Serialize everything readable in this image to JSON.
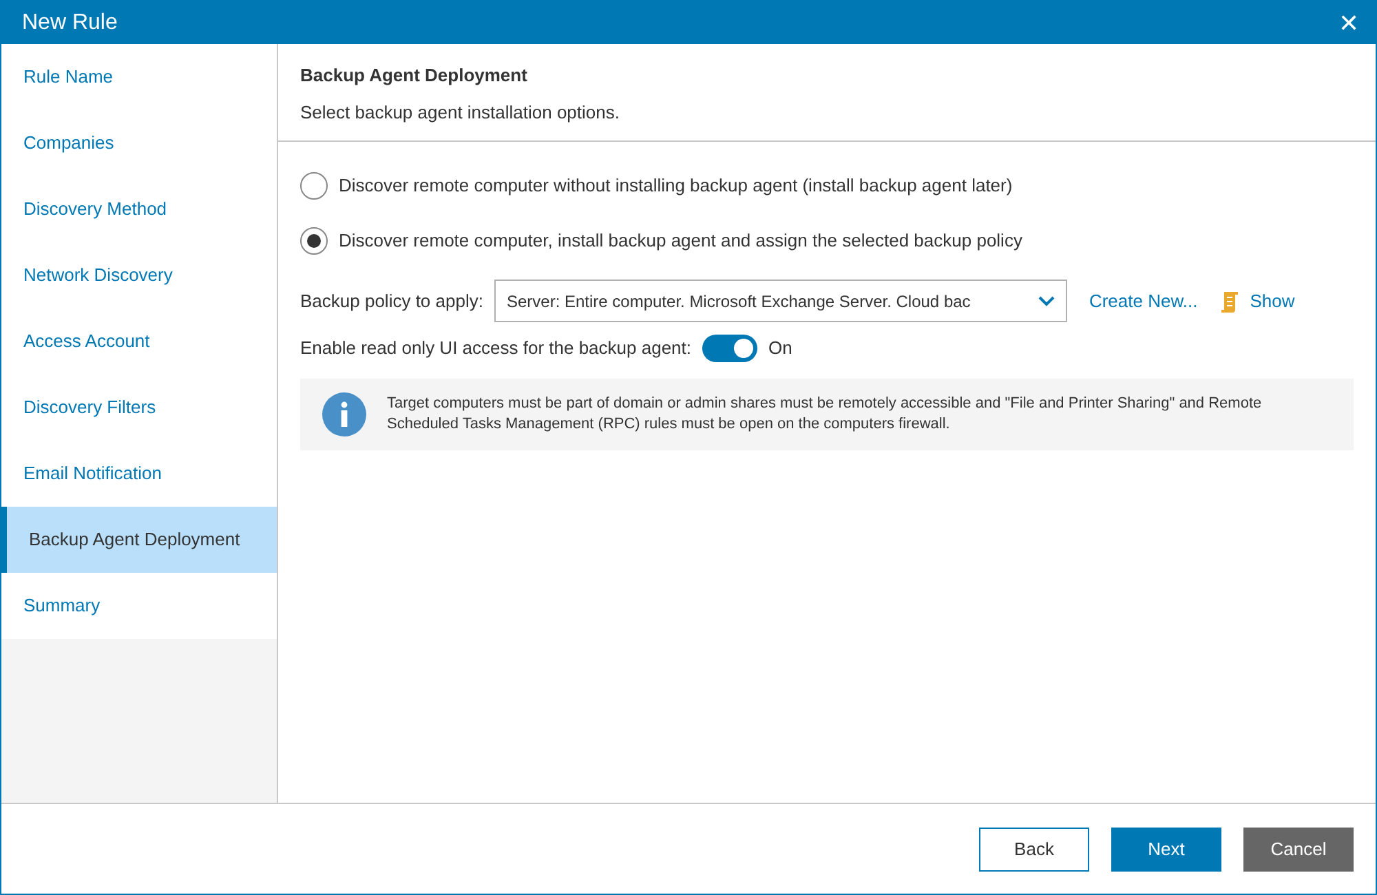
{
  "window": {
    "title": "New Rule",
    "close": "✕"
  },
  "sidebar": {
    "items": [
      {
        "label": "Rule Name",
        "selected": false
      },
      {
        "label": "Companies",
        "selected": false
      },
      {
        "label": "Discovery Method",
        "selected": false
      },
      {
        "label": "Network Discovery",
        "selected": false
      },
      {
        "label": "Access Account",
        "selected": false
      },
      {
        "label": "Discovery Filters",
        "selected": false
      },
      {
        "label": "Email Notification",
        "selected": false
      },
      {
        "label": "Backup Agent Deployment",
        "selected": true
      },
      {
        "label": "Summary",
        "selected": false
      }
    ]
  },
  "header": {
    "title": "Backup Agent Deployment",
    "subtitle": "Select backup agent installation options."
  },
  "options": [
    {
      "label": "Discover remote computer without installing backup agent (install backup agent later)",
      "selected": false
    },
    {
      "label": "Discover remote computer, install backup agent and assign the selected backup policy",
      "selected": true
    }
  ],
  "policy": {
    "label": "Backup policy to apply:",
    "value": "Server: Entire computer. Microsoft Exchange Server. Cloud bac",
    "create_link": "Create New...",
    "show_link": "Show"
  },
  "ui_access": {
    "label": "Enable read only UI access for the backup agent:",
    "on": true,
    "state_text": "On"
  },
  "info": "Target computers must be part of domain or admin shares must be remotely accessible and \"File and Printer Sharing\" and Remote Scheduled Tasks Management (RPC) rules must be open on the computers firewall.",
  "buttons": [
    {
      "label": "Back",
      "kind": "outline"
    },
    {
      "label": "Next",
      "kind": "primary"
    },
    {
      "label": "Cancel",
      "kind": "secondary"
    }
  ]
}
